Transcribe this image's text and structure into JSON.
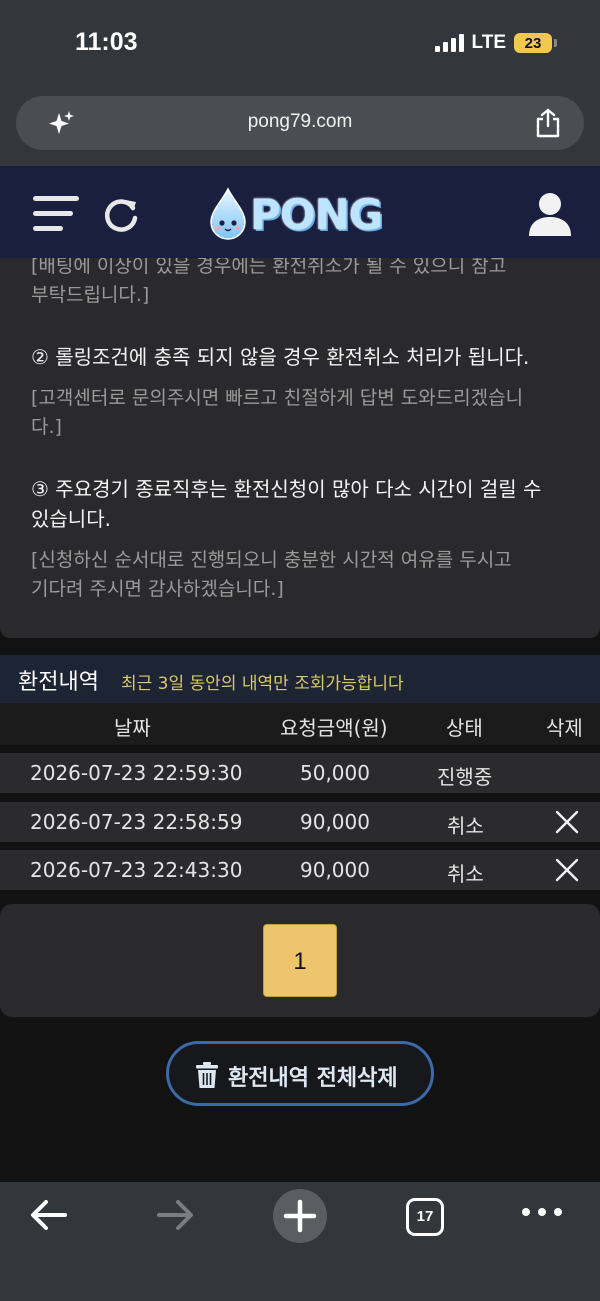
{
  "status": {
    "time": "11:03",
    "network": "LTE",
    "battery": "23"
  },
  "browser": {
    "url": "pong79.com",
    "tab_count": "17"
  },
  "site": {
    "logo_text": "PONG"
  },
  "notice": {
    "line_top_cut": "[배팅에 이상이 있을 경우에는 환전취소가 될 수 있으니 참고",
    "line_top_cont": "부탁드립니다.]",
    "item2_title": "② 롤링조건에 충족 되지 않을 경우 환전취소 처리가 됩니다.",
    "item2_note_1": "[고객센터로 문의주시면 빠르고 친절하게 답변 도와드리겠습니",
    "item2_note_2": "다.]",
    "item3_title_1": "③ 주요경기 종료직후는 환전신청이 많아 다소 시간이 걸릴 수",
    "item3_title_2": "있습니다.",
    "item3_note_1": "[신청하신 순서대로 진행되오니 충분한 시간적 여유를 두시고",
    "item3_note_2": "기다려 주시면 감사하겠습니다.]"
  },
  "history": {
    "title": "환전내역",
    "subtitle": "최근 3일 동안의 내역만 조회가능합니다",
    "columns": {
      "date": "날짜",
      "amount": "요청금액(원)",
      "status": "상태",
      "delete": "삭제"
    },
    "rows": [
      {
        "date": "2026-07-23 22:59:30",
        "amount": "50,000",
        "status": "진행중"
      },
      {
        "date": "2026-07-23 22:58:59",
        "amount": "90,000",
        "status": "취소"
      },
      {
        "date": "2026-07-23 22:43:30",
        "amount": "90,000",
        "status": "취소"
      }
    ]
  },
  "pagination": {
    "current": "1"
  },
  "actions": {
    "delete_all": "환전내역 전체삭제"
  },
  "colors": {
    "header_bg": "#1b1f3f",
    "page_active": "#ecc56d",
    "subtitle": "#d8c96a",
    "button_border": "#3c6aa8"
  }
}
